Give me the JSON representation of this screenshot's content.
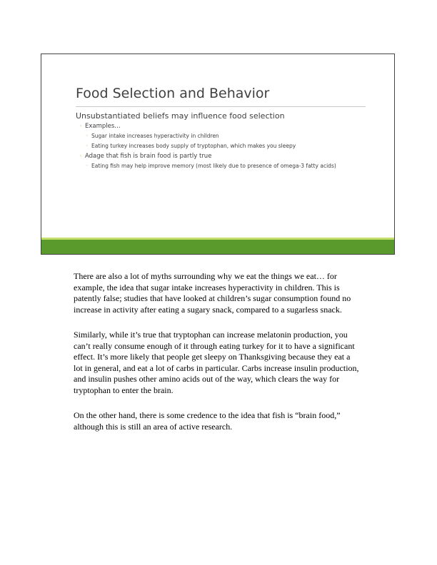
{
  "slide": {
    "title": "Food Selection and Behavior",
    "heading": "Unsubstantiated beliefs may influence food selection",
    "examples_label": "Examples…",
    "example_1": "Sugar intake increases hyperactivity in children",
    "example_2": "Eating turkey increases body supply of tryptophan, which makes you sleepy",
    "adage": "Adage that fish is brain food is partly true",
    "adage_detail": "Eating fish may help improve memory (most likely due to presence of omega-3 fatty acids)",
    "bullet_glyph": "◦",
    "colors": {
      "accent_dark": "#5a9a2c",
      "accent_light": "#c5e06a",
      "text": "#404040"
    }
  },
  "notes": {
    "p1": "There are also a lot of myths surrounding why we eat the things we eat… for example, the idea that sugar intake increases hyperactivity in children. This is patently false; studies that have looked at children’s sugar consumption found no increase in activity after eating a sugary snack, compared to a sugarless snack.",
    "p2": "Similarly, while it’s true that tryptophan can increase melatonin production, you can’t really consume enough of it through eating turkey for it to have a significant effect. It’s more likely that people get sleepy on Thanksgiving because they eat a lot in general, and eat a lot of carbs in particular. Carbs increase insulin production, and insulin pushes other amino acids out of the way, which clears the way for tryptophan to enter the brain.",
    "p3": "On the other hand, there is some credence to the idea that fish is “brain food,” although this is still an area of active research."
  }
}
